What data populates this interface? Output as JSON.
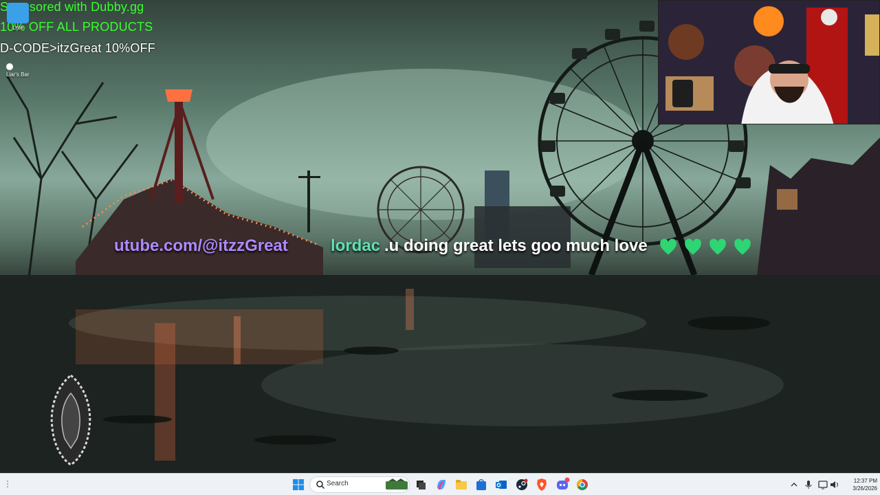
{
  "overlay": {
    "sponsor_line1": "Sponsored with Dubby.gg",
    "sponsor_line2": "10% OFF ALL PRODUCTS",
    "sponsor_line3": "D-CODE>itzGreat 10%OFF"
  },
  "desktop": {
    "icons": [
      {
        "label": "Lnte",
        "icon": "app-shortcut-icon"
      },
      {
        "label": "Liar's Bar",
        "icon": "liars-bar-icon"
      }
    ]
  },
  "chat_ticker": {
    "url_text": "utube.com/@itzzGreat",
    "username": "lordac",
    "message": ".u doing great lets goo much love",
    "emotes": [
      "green-heart-icon",
      "green-heart-icon",
      "green-heart-icon",
      "green-heart-icon"
    ],
    "colors": {
      "url": "#b089ff",
      "username": "#5ee0b4",
      "heart": "#2ed573"
    }
  },
  "taskbar": {
    "search_placeholder": "Search",
    "pinned": [
      "windows-start-icon",
      "search-icon",
      "task-view-icon",
      "copilot-icon",
      "file-explorer-icon",
      "microsoft-store-icon",
      "outlook-icon",
      "steam-icon",
      "brave-browser-icon",
      "discord-icon",
      "chrome-icon"
    ],
    "tray": [
      "chevron-up-icon",
      "microphone-icon",
      "display-icon",
      "volume-icon"
    ],
    "clock_time": "12:37 PM",
    "clock_date": "3/26/2026"
  }
}
